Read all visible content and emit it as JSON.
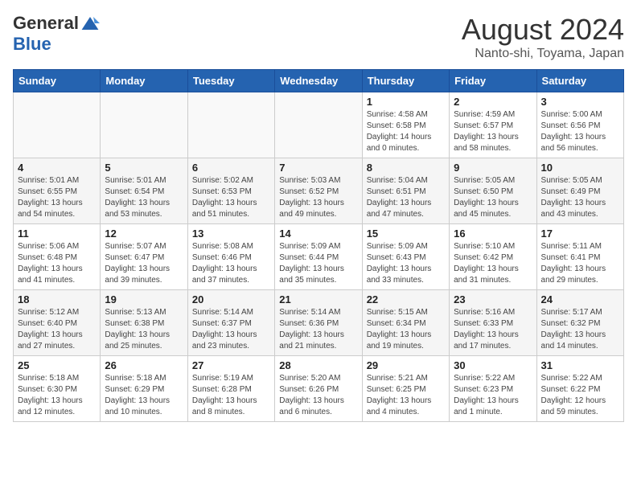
{
  "header": {
    "logo_general": "General",
    "logo_blue": "Blue",
    "month_year": "August 2024",
    "location": "Nanto-shi, Toyama, Japan"
  },
  "weekdays": [
    "Sunday",
    "Monday",
    "Tuesday",
    "Wednesday",
    "Thursday",
    "Friday",
    "Saturday"
  ],
  "weeks": [
    [
      {
        "day": "",
        "detail": ""
      },
      {
        "day": "",
        "detail": ""
      },
      {
        "day": "",
        "detail": ""
      },
      {
        "day": "",
        "detail": ""
      },
      {
        "day": "1",
        "detail": "Sunrise: 4:58 AM\nSunset: 6:58 PM\nDaylight: 14 hours\nand 0 minutes."
      },
      {
        "day": "2",
        "detail": "Sunrise: 4:59 AM\nSunset: 6:57 PM\nDaylight: 13 hours\nand 58 minutes."
      },
      {
        "day": "3",
        "detail": "Sunrise: 5:00 AM\nSunset: 6:56 PM\nDaylight: 13 hours\nand 56 minutes."
      }
    ],
    [
      {
        "day": "4",
        "detail": "Sunrise: 5:01 AM\nSunset: 6:55 PM\nDaylight: 13 hours\nand 54 minutes."
      },
      {
        "day": "5",
        "detail": "Sunrise: 5:01 AM\nSunset: 6:54 PM\nDaylight: 13 hours\nand 53 minutes."
      },
      {
        "day": "6",
        "detail": "Sunrise: 5:02 AM\nSunset: 6:53 PM\nDaylight: 13 hours\nand 51 minutes."
      },
      {
        "day": "7",
        "detail": "Sunrise: 5:03 AM\nSunset: 6:52 PM\nDaylight: 13 hours\nand 49 minutes."
      },
      {
        "day": "8",
        "detail": "Sunrise: 5:04 AM\nSunset: 6:51 PM\nDaylight: 13 hours\nand 47 minutes."
      },
      {
        "day": "9",
        "detail": "Sunrise: 5:05 AM\nSunset: 6:50 PM\nDaylight: 13 hours\nand 45 minutes."
      },
      {
        "day": "10",
        "detail": "Sunrise: 5:05 AM\nSunset: 6:49 PM\nDaylight: 13 hours\nand 43 minutes."
      }
    ],
    [
      {
        "day": "11",
        "detail": "Sunrise: 5:06 AM\nSunset: 6:48 PM\nDaylight: 13 hours\nand 41 minutes."
      },
      {
        "day": "12",
        "detail": "Sunrise: 5:07 AM\nSunset: 6:47 PM\nDaylight: 13 hours\nand 39 minutes."
      },
      {
        "day": "13",
        "detail": "Sunrise: 5:08 AM\nSunset: 6:46 PM\nDaylight: 13 hours\nand 37 minutes."
      },
      {
        "day": "14",
        "detail": "Sunrise: 5:09 AM\nSunset: 6:44 PM\nDaylight: 13 hours\nand 35 minutes."
      },
      {
        "day": "15",
        "detail": "Sunrise: 5:09 AM\nSunset: 6:43 PM\nDaylight: 13 hours\nand 33 minutes."
      },
      {
        "day": "16",
        "detail": "Sunrise: 5:10 AM\nSunset: 6:42 PM\nDaylight: 13 hours\nand 31 minutes."
      },
      {
        "day": "17",
        "detail": "Sunrise: 5:11 AM\nSunset: 6:41 PM\nDaylight: 13 hours\nand 29 minutes."
      }
    ],
    [
      {
        "day": "18",
        "detail": "Sunrise: 5:12 AM\nSunset: 6:40 PM\nDaylight: 13 hours\nand 27 minutes."
      },
      {
        "day": "19",
        "detail": "Sunrise: 5:13 AM\nSunset: 6:38 PM\nDaylight: 13 hours\nand 25 minutes."
      },
      {
        "day": "20",
        "detail": "Sunrise: 5:14 AM\nSunset: 6:37 PM\nDaylight: 13 hours\nand 23 minutes."
      },
      {
        "day": "21",
        "detail": "Sunrise: 5:14 AM\nSunset: 6:36 PM\nDaylight: 13 hours\nand 21 minutes."
      },
      {
        "day": "22",
        "detail": "Sunrise: 5:15 AM\nSunset: 6:34 PM\nDaylight: 13 hours\nand 19 minutes."
      },
      {
        "day": "23",
        "detail": "Sunrise: 5:16 AM\nSunset: 6:33 PM\nDaylight: 13 hours\nand 17 minutes."
      },
      {
        "day": "24",
        "detail": "Sunrise: 5:17 AM\nSunset: 6:32 PM\nDaylight: 13 hours\nand 14 minutes."
      }
    ],
    [
      {
        "day": "25",
        "detail": "Sunrise: 5:18 AM\nSunset: 6:30 PM\nDaylight: 13 hours\nand 12 minutes."
      },
      {
        "day": "26",
        "detail": "Sunrise: 5:18 AM\nSunset: 6:29 PM\nDaylight: 13 hours\nand 10 minutes."
      },
      {
        "day": "27",
        "detail": "Sunrise: 5:19 AM\nSunset: 6:28 PM\nDaylight: 13 hours\nand 8 minutes."
      },
      {
        "day": "28",
        "detail": "Sunrise: 5:20 AM\nSunset: 6:26 PM\nDaylight: 13 hours\nand 6 minutes."
      },
      {
        "day": "29",
        "detail": "Sunrise: 5:21 AM\nSunset: 6:25 PM\nDaylight: 13 hours\nand 4 minutes."
      },
      {
        "day": "30",
        "detail": "Sunrise: 5:22 AM\nSunset: 6:23 PM\nDaylight: 13 hours\nand 1 minute."
      },
      {
        "day": "31",
        "detail": "Sunrise: 5:22 AM\nSunset: 6:22 PM\nDaylight: 12 hours\nand 59 minutes."
      }
    ]
  ]
}
